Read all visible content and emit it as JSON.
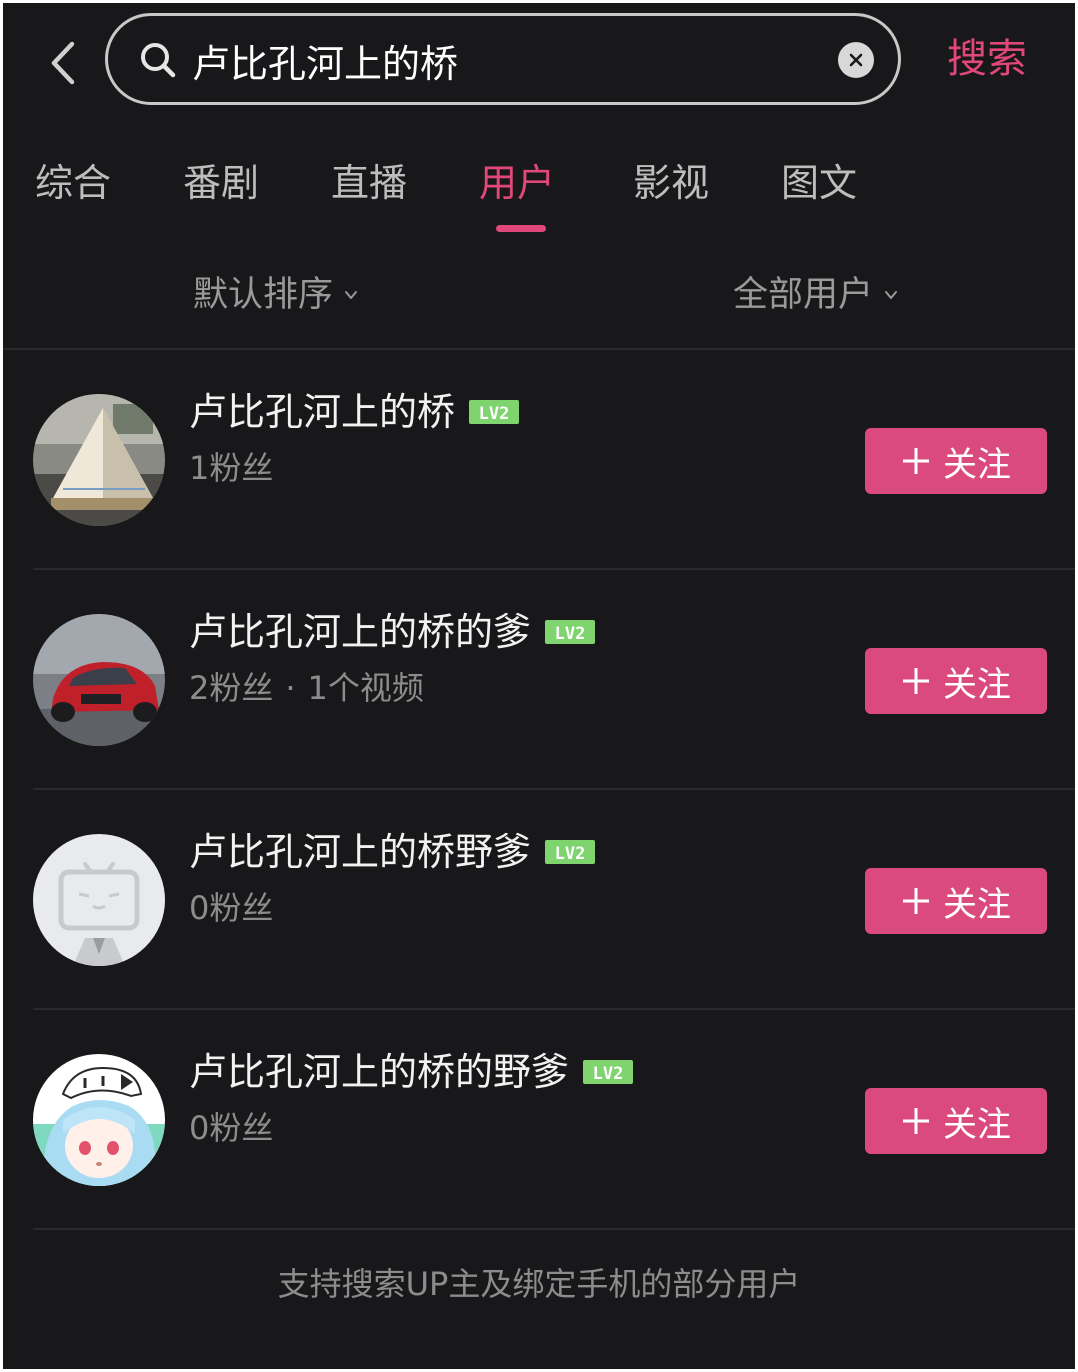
{
  "search": {
    "query": "卢比孔河上的桥",
    "submit_label": "搜索"
  },
  "tabs": [
    {
      "label": "综合",
      "active": false
    },
    {
      "label": "番剧",
      "active": false
    },
    {
      "label": "直播",
      "active": false
    },
    {
      "label": "用户",
      "active": true
    },
    {
      "label": "影视",
      "active": false
    },
    {
      "label": "图文",
      "active": false
    }
  ],
  "filters": {
    "sort_label": "默认排序",
    "user_type_label": "全部用户"
  },
  "users": [
    {
      "name": "卢比孔河上的桥",
      "level": "LV2",
      "fans": "1粉丝",
      "videos": "",
      "follow_label": "关注",
      "avatar": "pyramid-photo"
    },
    {
      "name": "卢比孔河上的桥的爹",
      "level": "LV2",
      "fans": "2粉丝",
      "videos": "1个视频",
      "follow_label": "关注",
      "avatar": "red-car-photo"
    },
    {
      "name": "卢比孔河上的桥野爹",
      "level": "LV2",
      "fans": "0粉丝",
      "videos": "",
      "follow_label": "关注",
      "avatar": "default-tv-avatar"
    },
    {
      "name": "卢比孔河上的桥的野爹",
      "level": "LV2",
      "fans": "0粉丝",
      "videos": "",
      "follow_label": "关注",
      "avatar": "anime-girl-avatar"
    }
  ],
  "footer_note": "支持搜索UP主及绑定手机的部分用户",
  "colors": {
    "accent": "#e0477a",
    "follow_button": "#db4a7d",
    "background": "#18181a",
    "level_badge": "#7fd46f"
  }
}
